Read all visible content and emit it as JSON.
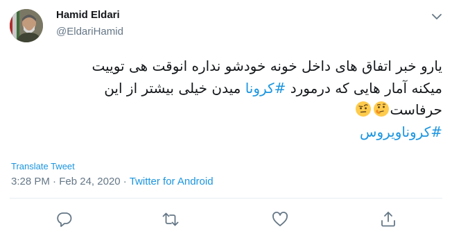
{
  "author": {
    "name": "Hamid Eldari",
    "handle": "@EldariHamid"
  },
  "tweet": {
    "line1": "یارو خبر اتفاق های داخل خونه خودشو نداره انوقت هی توییت",
    "line2_before": "میکنه آمار هایی که درمورد ",
    "line2_hashtag": "#کرونا",
    "line2_after": "  میدن خیلی بیشتر از این",
    "line3": "حرفاست",
    "line3_emojis": [
      "thinking-face-emoji",
      "face-with-raised-eyebrow-emoji"
    ],
    "line4_hashtag": "#کروناویروس"
  },
  "translate_label": "Translate Tweet",
  "meta": {
    "time": "3:28 PM",
    "separator": " · ",
    "date": "Feb 24, 2020",
    "source": "Twitter for Android"
  },
  "actions": [
    "reply-icon",
    "retweet-icon",
    "like-icon",
    "share-icon"
  ],
  "colors": {
    "accent": "#1b95e0",
    "secondary_text": "#657786",
    "primary_text": "#14171a",
    "icon": "#657786",
    "divider": "#e6ecf0"
  }
}
